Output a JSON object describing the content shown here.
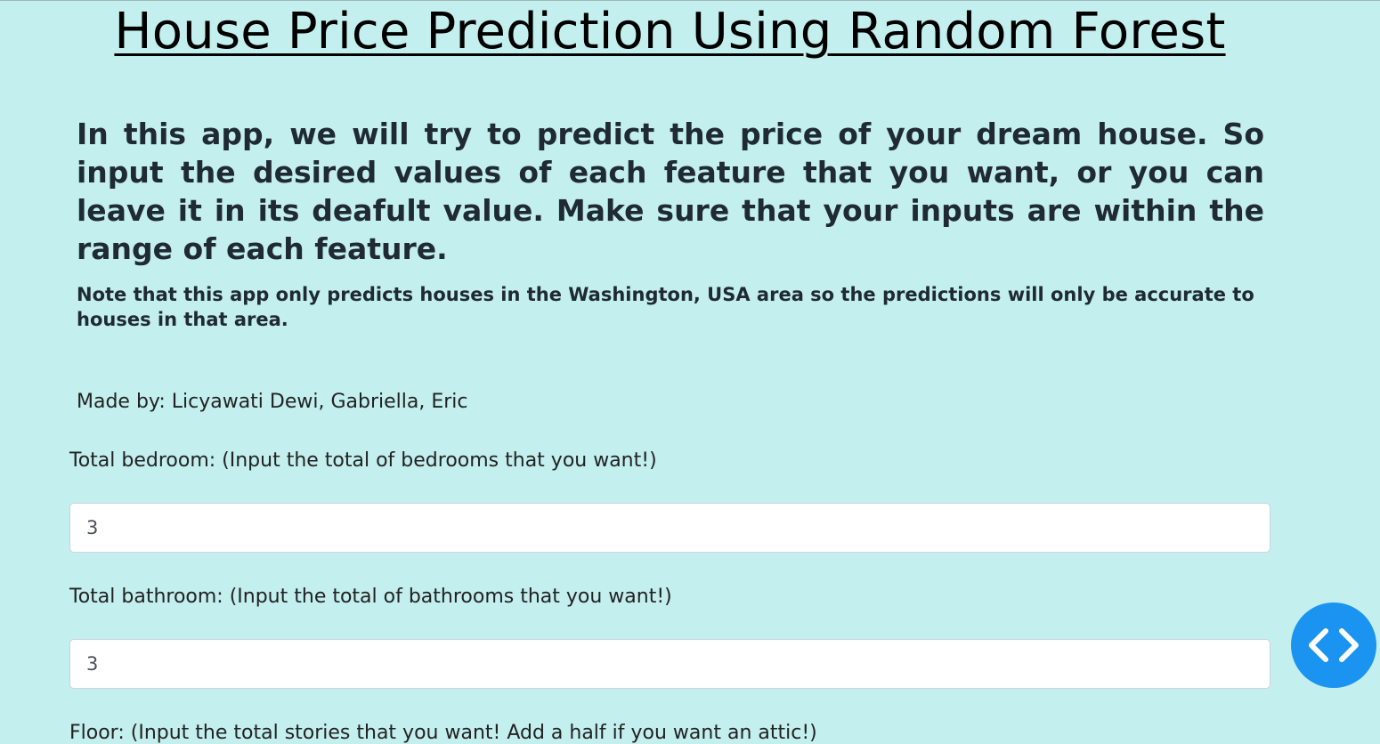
{
  "page": {
    "title": "House Price Prediction Using Random Forest",
    "intro": "In this app, we will try to predict the price of your dream house. So input the desired values of each feature that you want, or you can leave it in its deafult value. Make sure that your inputs are within the range of each feature.",
    "note": "Note that this app only predicts houses in the Washington, USA area so the predictions will only be accurate to houses in that area.",
    "credits": "Made by: Licyawati Dewi, Gabriella, Eric"
  },
  "form": {
    "fields": [
      {
        "label": "Total bedroom: (Input the total of bedrooms that you want!)",
        "value": "3"
      },
      {
        "label": "Total bathroom: (Input the total of bathrooms that you want!)",
        "value": "3"
      },
      {
        "label": "Floor: (Input the total stories that you want! Add a half if you want an attic!)"
      }
    ]
  },
  "floating_button": {
    "icon": "code-brackets-icon",
    "color": "#1a94f0"
  },
  "colors": {
    "background": "#c3efee",
    "accent": "#1a94f0"
  }
}
